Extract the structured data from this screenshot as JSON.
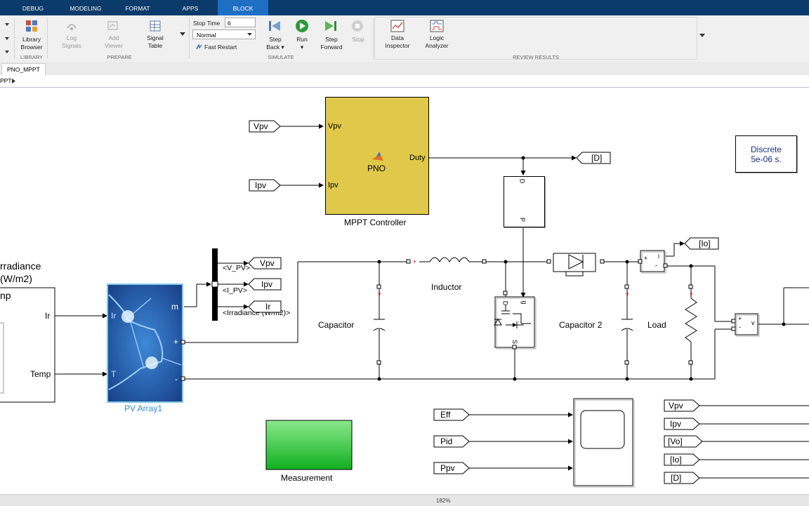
{
  "ribbon": {
    "tabs": [
      "DEBUG",
      "MODELING",
      "FORMAT",
      "APPS",
      "BLOCK"
    ],
    "active_tab": "BLOCK",
    "library": {
      "label_line1": "Library",
      "label_line2": "Browser",
      "section": "LIBRARY"
    },
    "prepare": {
      "log_signals_1": "Log",
      "log_signals_2": "Signals",
      "add_viewer_1": "Add",
      "add_viewer_2": "Viewer",
      "signal_table_1": "Signal",
      "signal_table_2": "Table",
      "section": "PREPARE"
    },
    "simulate": {
      "stop_time_label": "Stop Time",
      "stop_time_value": "6",
      "mode_value": "Normal",
      "fast_restart": "Fast Restart",
      "step_back_1": "Step",
      "step_back_2": "Back",
      "run": "Run",
      "step_forward_1": "Step",
      "step_forward_2": "Forward",
      "stop": "Stop",
      "section": "SIMULATE"
    },
    "review": {
      "data_inspector_1": "Data",
      "data_inspector_2": "Inspector",
      "logic_analyzer_1": "Logic",
      "logic_analyzer_2": "Analyzer",
      "section": "REVIEW RESULTS"
    }
  },
  "document_tab": "PNO_MPPT",
  "breadcrumb": "PPT",
  "status": {
    "zoom": "182%"
  },
  "colors": {
    "ribbon_tabbar": "#0b3a6b",
    "active_tab": "#1e6fc4",
    "controller_fill": "#e0c84a",
    "measurement_fill": "#22c43a",
    "pv_blue": "#1f5fb0"
  },
  "diagram": {
    "controller": {
      "name": "MPPT Controller",
      "function": "PNO",
      "in1": "Vpv",
      "in2": "Ipv",
      "out": "Duty"
    },
    "goto_vpv_in": "Vpv",
    "goto_ipv_in": "Ipv",
    "goto_d": "[D]",
    "solver": {
      "line1": "Discrete",
      "line2": "5e-06 s."
    },
    "pwm": {
      "port_top": "D",
      "port_bottom": "P"
    },
    "goto_io": "[Io]",
    "irradiance": {
      "line1": "rradiance",
      "line2": "(W/m2)",
      "temp_part": "np",
      "out_ir": "Ir",
      "out_temp": "Temp"
    },
    "pv": {
      "name": "PV Array1",
      "in_ir": "Ir",
      "in_t": "T",
      "out_m": "m",
      "plus": "+",
      "minus": "-"
    },
    "bus": {
      "sig1": "<V_PV>",
      "sig2": "<I_PV>",
      "sig3": "<Irradiance (W/m2)>",
      "goto1": "Vpv",
      "goto2": "Ipv",
      "goto3": "Ir"
    },
    "labels": {
      "inductor": "Inductor",
      "capacitor": "Capacitor",
      "capacitor2": "Capacitor 2",
      "load": "Load"
    },
    "mosfet": {
      "g": "g",
      "d": "D",
      "s": "S"
    },
    "current_meas": {
      "plus": "+",
      "i": "i",
      "minus": "-"
    },
    "voltage_meas": {
      "plus": "+",
      "minus": "-",
      "v": "v"
    },
    "measurement": {
      "name": "Measurement"
    },
    "scope_inputs": [
      "Eff",
      "Pid",
      "Ppv"
    ],
    "right_tags": [
      "Vpv",
      "Ipv",
      "[Vo]",
      "[Io]",
      "[D]"
    ]
  }
}
